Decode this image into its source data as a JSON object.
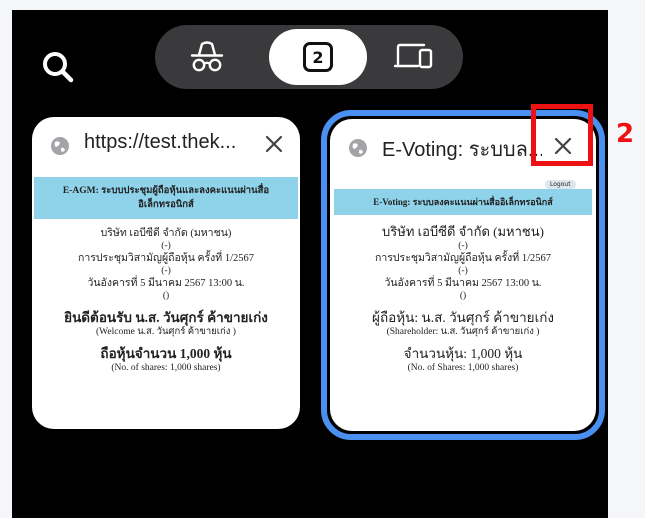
{
  "toolbar": {
    "search_icon": "search-icon",
    "tab_count": "2",
    "segments": [
      "private-browsing-icon",
      "tab-count",
      "devices-icon"
    ]
  },
  "tabs": [
    {
      "title": "https://test.thek...",
      "banner": "E-AGM: ระบบประชุมผู้ถือหุ้นและลงคะแนนผ่านสื่ออิเล็กทรอนิกส์",
      "lines": [
        "บริษัท เอบีซีดี จำกัด (มหาชน)",
        "(-)",
        "การประชุมวิสามัญผู้ถือหุ้น ครั้งที่ 1/2567",
        "(-)",
        "วันอังคารที่ 5 มีนาคม 2567 13:00 น.",
        "()"
      ],
      "welcome": "ยินดีต้อนรับ น.ส. วันศุกร์ ค้าขายเก่ง",
      "welcome_en": "(Welcome น.ส. วันศุกร์ ค้าขายเก่ง )",
      "shares": "ถือหุ้นจำนวน 1,000 หุ้น",
      "shares_en": "(No. of shares: 1,000 shares)"
    },
    {
      "title": "E-Voting: ระบบล...",
      "logout": "Logout",
      "banner": "E-Voting: ระบบลงคะแนนผ่านสื่ออิเล็กทรอนิกส์",
      "company": "บริษัท เอบีซีดี จำกัด (มหาชน)",
      "lines": [
        "(-)",
        "การประชุมวิสามัญผู้ถือหุ้น ครั้งที่ 1/2567",
        "(-)",
        "วันอังคารที่ 5 มีนาคม 2567 13:00 น.",
        "()"
      ],
      "holder": "ผู้ถือหุ้น: น.ส. วันศุกร์ ค้าขายเก่ง",
      "holder_en": "(Shareholder: น.ส. วันศุกร์ ค้าขายเก่ง )",
      "shares": "จำนวนหุ้น: 1,000 หุ้น",
      "shares_en": "(No. of Shares: 1,000 shares)"
    }
  ],
  "annotation": {
    "number": "2",
    "color": "#e11111"
  },
  "colors": {
    "selected_border": "#4a90f0",
    "banner": "#8fd3ea"
  }
}
